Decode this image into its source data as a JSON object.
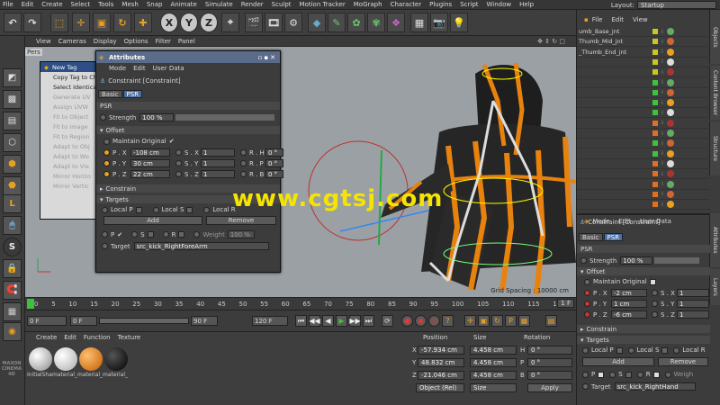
{
  "menubar": [
    "File",
    "Edit",
    "Create",
    "Select",
    "Tools",
    "Mesh",
    "Snap",
    "Animate",
    "Simulate",
    "Render",
    "Sculpt",
    "Motion Tracker",
    "MoGraph",
    "Character",
    "Plugins",
    "Script",
    "Window",
    "Help"
  ],
  "layout": {
    "label": "Layout:",
    "value": "Startup"
  },
  "toolbar": {
    "x": "X",
    "y": "Y",
    "z": "Z"
  },
  "lefttools": {
    "s_label": "S"
  },
  "viewport": {
    "menu": [
      "View",
      "Cameras",
      "Display",
      "Options",
      "Filter",
      "Panel"
    ],
    "name_partial": "Pers",
    "grid_spacing": "Grid Spacing : 10000 cm"
  },
  "context_menu": [
    {
      "label": "New Tag",
      "enabled": true
    },
    {
      "label": "Copy Tag to Ch",
      "enabled": true
    },
    {
      "label": "Select Identical",
      "enabled": true
    },
    {
      "label": "Generate UV",
      "enabled": false
    },
    {
      "label": "Assign UVW",
      "enabled": false
    },
    {
      "label": "Fit to Object",
      "enabled": false
    },
    {
      "label": "Fit to Image",
      "enabled": false
    },
    {
      "label": "Fit to Region",
      "enabled": false
    },
    {
      "label": "Adapt to Obj",
      "enabled": false
    },
    {
      "label": "Adapt to Wo",
      "enabled": false
    },
    {
      "label": "Adapt to Vie",
      "enabled": false
    },
    {
      "label": "Mirror Horizo",
      "enabled": false
    },
    {
      "label": "Mirror Vertic",
      "enabled": false
    }
  ],
  "attributes_dialog": {
    "title": "Attributes",
    "menu": [
      "Mode",
      "Edit",
      "User Data"
    ],
    "object": "Constraint [Constraint]",
    "tabs": [
      "Basic",
      "PSR"
    ],
    "section": "PSR",
    "strength_label": "Strength",
    "strength_value": "100 %",
    "offset_label": "Offset",
    "maintain_original": "Maintain Original",
    "p_labels": [
      "P . X",
      "P . Y",
      "P . Z"
    ],
    "p_values": [
      "-108 cm",
      "30 cm",
      "22 cm"
    ],
    "s_labels": [
      "S . X",
      "S . Y",
      "S . Z"
    ],
    "s_values": [
      "1",
      "1",
      "1"
    ],
    "r_labels": [
      "R . H",
      "R . P",
      "R . B"
    ],
    "r_values": [
      "0 °",
      "0 °",
      "0 °"
    ],
    "constrain_label": "Constrain",
    "targets_label": "Targets",
    "local_p": "Local P",
    "local_s": "Local S",
    "local_r": "Local R",
    "add": "Add",
    "remove": "Remove",
    "p_short": "P",
    "s_short": "S",
    "r_short": "R",
    "weight_label": "Weight",
    "weight_value": "100 %",
    "target_label": "Target",
    "target_value": "src_kick_RightForeArm"
  },
  "watermark": "www.cgtsj.com",
  "timeline": {
    "ticks": [
      "0",
      "5",
      "10",
      "15",
      "20",
      "25",
      "30",
      "35",
      "40",
      "45",
      "50",
      "55",
      "60",
      "65",
      "70",
      "75",
      "80",
      "85",
      "90",
      "95",
      "100",
      "105",
      "110",
      "115",
      "120"
    ],
    "current_frame": "1 F",
    "start": "0 F",
    "range_start": "0 F",
    "range_end": "90 F",
    "end": "120 F",
    "play_symbols": [
      "⏮",
      "◀◀",
      "◀",
      "▶",
      "▶▶",
      "⏭"
    ]
  },
  "materials": {
    "menu": [
      "Create",
      "Edit",
      "Function",
      "Texture"
    ],
    "items": [
      {
        "label": "InitialSha",
        "color": "#cfcfcf"
      },
      {
        "label": "material_",
        "color": "#e8e8e8"
      },
      {
        "label": "material_",
        "color": "#e87a12"
      },
      {
        "label": "material_",
        "color": "#161616"
      }
    ],
    "brand": "MAXON CINEMA 4D"
  },
  "coordinates": {
    "headers": [
      "Position",
      "Size",
      "Rotation"
    ],
    "axes": [
      "X",
      "Y",
      "Z"
    ],
    "position": [
      "-57.934 cm",
      "48.832 cm",
      "-21.046 cm"
    ],
    "size": [
      "4.458 cm",
      "4.458 cm",
      "4.458 cm"
    ],
    "rot_labels": [
      "H",
      "P",
      "B"
    ],
    "rotation": [
      "0 °",
      "0 °",
      "0 °"
    ],
    "mode": "Object (Rel)",
    "size_mode": "Size",
    "apply": "Apply"
  },
  "object_manager": {
    "menu": [
      "File",
      "Edit",
      "View"
    ],
    "rows": [
      {
        "name": "umb_Base_jnt",
        "color": "#c8c820"
      },
      {
        "name": "Thumb_Mid_jnt",
        "color": "#c8c820"
      },
      {
        "name": "_Thumb_End_jnt",
        "color": "#c8c820"
      },
      {
        "name": "",
        "color": "#c8c820"
      },
      {
        "name": "",
        "color": "#c8c820"
      },
      {
        "name": "",
        "color": "#40c040"
      },
      {
        "name": "",
        "color": "#40c040"
      },
      {
        "name": "",
        "color": "#40c040"
      },
      {
        "name": "",
        "color": "#40c040"
      },
      {
        "name": "",
        "color": "#e07020"
      },
      {
        "name": "",
        "color": "#e07020"
      },
      {
        "name": "",
        "color": "#40c040"
      },
      {
        "name": "",
        "color": "#40c040"
      },
      {
        "name": "",
        "color": "#e07020"
      },
      {
        "name": "",
        "color": "#e07020"
      },
      {
        "name": "",
        "color": "#e07020"
      },
      {
        "name": "",
        "color": "#e07020"
      },
      {
        "name": "",
        "color": "#e07020"
      }
    ]
  },
  "right_attributes": {
    "menu": [
      "Mode",
      "Edit",
      "User Data"
    ],
    "object": "Constraint [Constraint]",
    "tabs": [
      "Basic",
      "PSR"
    ],
    "section": "PSR",
    "strength_label": "Strength",
    "strength_value": "100 %",
    "offset_label": "Offset",
    "maintain_original": "Maintain Original",
    "p_labels": [
      "P . X",
      "P . Y",
      "P . Z"
    ],
    "p_values": [
      "-2 cm",
      "1 cm",
      "-6 cm"
    ],
    "s_labels": [
      "S . X",
      "S . Y",
      "S . Z"
    ],
    "s_values": [
      "1",
      "1",
      "1"
    ],
    "constrain_label": "Constrain",
    "targets_label": "Targets",
    "local_p": "Local P",
    "local_s": "Local S",
    "local_r": "Local R",
    "add": "Add",
    "remove": "Remove",
    "p_short": "P",
    "s_short": "S",
    "r_short": "R",
    "weight_label": "Weigh",
    "target_label": "Target",
    "target_value": "src_kick_RightHand"
  },
  "side_tabs": [
    "Objects",
    "Content Browser",
    "Structure",
    "Attributes",
    "Layers"
  ],
  "colors": {
    "accent": "#4a6fa5",
    "orange": "#e8820e",
    "selection": "#2e4f86",
    "panel": "#3c3c3c"
  }
}
